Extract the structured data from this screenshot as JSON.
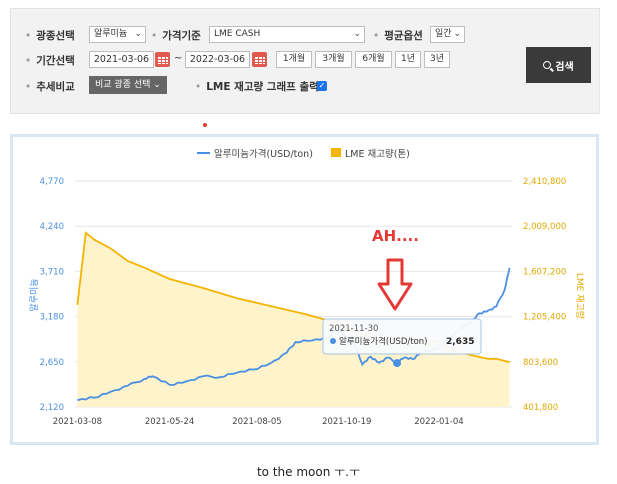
{
  "filters": {
    "item_label": "광종선택",
    "item_value": "알루미늄",
    "price_basis_label": "가격기준",
    "price_basis_value": "LME CASH",
    "average_label": "평균옵션",
    "average_value": "일간",
    "period_label": "기간선택",
    "start_date": "2021-03-06",
    "end_date": "2022-03-06",
    "tilde": "~",
    "period_buttons": [
      "1개월",
      "3개월",
      "6개월",
      "1년",
      "3년"
    ],
    "trend_label": "추세비교",
    "compare_button": "비교 광종 선택",
    "stock_label": "LME 재고량 그래프 출력",
    "stock_checked": true,
    "search_button": "검색"
  },
  "colors": {
    "price_line": "#4a90e2",
    "stock_line": "#f4b400",
    "stock_fill": "#fff3cc",
    "annotation": "#e53935"
  },
  "annotation_text": "AH....",
  "tooltip": {
    "date": "2021-11-30",
    "series": "알루미늄가격(USD/ton)",
    "value": "2,635"
  },
  "caption": "to the moon ㅜ.ㅜ",
  "chart_data": {
    "type": "line",
    "series": [
      {
        "name": "알루미늄가격(USD/ton)",
        "axis": "left",
        "x": [
          "2021-03-08",
          "2021-03-22",
          "2021-04-05",
          "2021-04-19",
          "2021-05-03",
          "2021-05-10",
          "2021-05-24",
          "2021-06-07",
          "2021-06-21",
          "2021-07-05",
          "2021-07-19",
          "2021-08-02",
          "2021-08-16",
          "2021-08-30",
          "2021-09-06",
          "2021-09-20",
          "2021-10-04",
          "2021-10-11",
          "2021-10-19",
          "2021-10-25",
          "2021-11-01",
          "2021-11-08",
          "2021-11-15",
          "2021-11-22",
          "2021-11-30",
          "2021-12-06",
          "2021-12-13",
          "2021-12-20",
          "2022-01-04",
          "2022-01-18",
          "2022-01-31",
          "2022-02-07",
          "2022-02-14",
          "2022-02-21",
          "2022-02-28",
          "2022-03-04"
        ],
        "values": [
          2200,
          2230,
          2300,
          2370,
          2450,
          2480,
          2380,
          2420,
          2480,
          2470,
          2520,
          2560,
          2630,
          2760,
          2880,
          2900,
          2930,
          3050,
          2920,
          2860,
          2620,
          2710,
          2640,
          2700,
          2635,
          2700,
          2680,
          2760,
          2810,
          3000,
          3120,
          3220,
          3250,
          3300,
          3500,
          3750
        ]
      },
      {
        "name": "LME 재고량(톤)",
        "axis": "right",
        "x": [
          "2021-03-08",
          "2021-03-15",
          "2021-03-22",
          "2021-04-05",
          "2021-04-19",
          "2021-05-03",
          "2021-05-24",
          "2021-06-21",
          "2021-07-19",
          "2021-08-16",
          "2021-09-13",
          "2021-10-04",
          "2021-10-19",
          "2021-11-01",
          "2021-11-15",
          "2021-11-30",
          "2021-12-13",
          "2022-01-04",
          "2022-01-18",
          "2022-02-01",
          "2022-02-14",
          "2022-02-21",
          "2022-03-04"
        ],
        "values": [
          1310000,
          1950000,
          1890000,
          1810000,
          1700000,
          1640000,
          1540000,
          1460000,
          1370000,
          1300000,
          1230000,
          1170000,
          1100000,
          1050000,
          1010000,
          1000000,
          990000,
          980000,
          900000,
          860000,
          830000,
          830000,
          800000
        ]
      }
    ],
    "y_left": {
      "label": "알루미늄",
      "ticks": [
        "4,770",
        "4,240",
        "3,710",
        "3,180",
        "2,650",
        "2,120"
      ],
      "range": [
        2120,
        4770
      ]
    },
    "y_right": {
      "label": "LME 재고량",
      "ticks": [
        "2,410,800",
        "2,009,000",
        "1,607,200",
        "1,205,400",
        "803,600",
        "401,800"
      ],
      "range": [
        401800,
        2410800
      ]
    },
    "x_ticks": [
      "2021-03-08",
      "2021-05-24",
      "2021-08-05",
      "2021-10-19",
      "2022-01-04"
    ],
    "legend": "top-center",
    "grid": true
  }
}
